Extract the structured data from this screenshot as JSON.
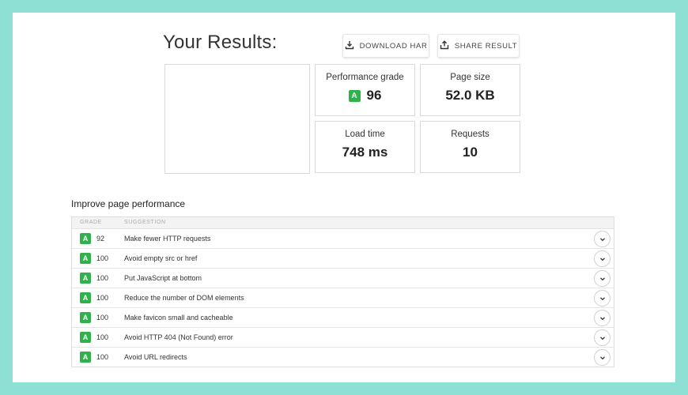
{
  "header": {
    "title": "Your Results:",
    "download_label": "DOWNLOAD HAR",
    "share_label": "SHARE RESULT"
  },
  "metrics": {
    "performance": {
      "label": "Performance grade",
      "grade": "A",
      "value": "96"
    },
    "page_size": {
      "label": "Page size",
      "value": "52.0 KB"
    },
    "load_time": {
      "label": "Load time",
      "value": "748 ms"
    },
    "requests": {
      "label": "Requests",
      "value": "10"
    }
  },
  "improve": {
    "title": "Improve page performance",
    "columns": {
      "grade": "GRADE",
      "suggestion": "SUGGESTION"
    },
    "rows": [
      {
        "grade": "A",
        "score": "92",
        "suggestion": "Make fewer HTTP requests"
      },
      {
        "grade": "A",
        "score": "100",
        "suggestion": "Avoid empty src or href"
      },
      {
        "grade": "A",
        "score": "100",
        "suggestion": "Put JavaScript at bottom"
      },
      {
        "grade": "A",
        "score": "100",
        "suggestion": "Reduce the number of DOM elements"
      },
      {
        "grade": "A",
        "score": "100",
        "suggestion": "Make favicon small and cacheable"
      },
      {
        "grade": "A",
        "score": "100",
        "suggestion": "Avoid HTTP 404 (Not Found) error"
      },
      {
        "grade": "A",
        "score": "100",
        "suggestion": "Avoid URL redirects"
      }
    ]
  },
  "colors": {
    "grade_a": "#2fb24c",
    "background": "#8ee0d4"
  }
}
